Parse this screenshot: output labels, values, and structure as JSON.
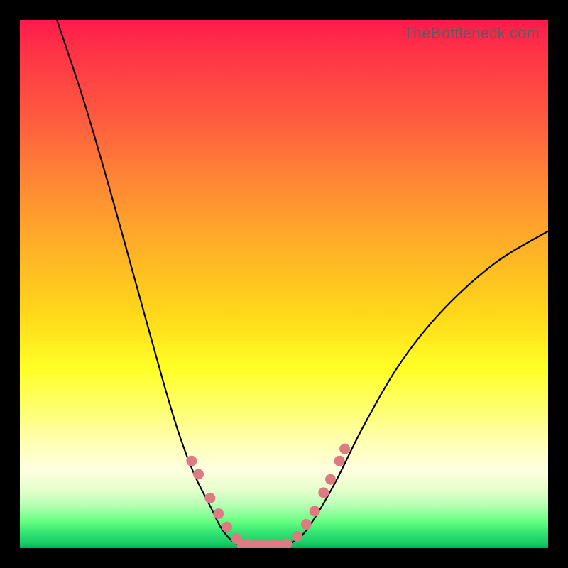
{
  "watermark": "TheBottleneck.com",
  "colors": {
    "frame": "#000000",
    "curve": "#000000",
    "marker": "#dd7b83",
    "gradient_top": "#ff1a4d",
    "gradient_bottom": "#00b359"
  },
  "chart_data": {
    "type": "line",
    "title": "",
    "xlabel": "",
    "ylabel": "",
    "xlim": [
      0,
      100
    ],
    "ylim": [
      0,
      100
    ],
    "annotations": [
      "TheBottleneck.com"
    ],
    "series": [
      {
        "name": "left-curve",
        "x": [
          7,
          12,
          17,
          22,
          27,
          30,
          33,
          36,
          38,
          40,
          42
        ],
        "y": [
          100,
          85,
          68,
          50,
          32,
          22,
          14,
          8,
          4,
          1.5,
          0.5
        ]
      },
      {
        "name": "right-curve",
        "x": [
          50,
          53,
          56,
          60,
          65,
          72,
          80,
          90,
          100
        ],
        "y": [
          0.5,
          2,
          6,
          13,
          23,
          35,
          45,
          54,
          60
        ]
      },
      {
        "name": "flat-bottom",
        "x": [
          42,
          50
        ],
        "y": [
          0.5,
          0.5
        ]
      }
    ],
    "markers_left": [
      {
        "x": 32.5,
        "y": 16.5
      },
      {
        "x": 33.8,
        "y": 14.0
      },
      {
        "x": 36.0,
        "y": 9.5
      },
      {
        "x": 37.6,
        "y": 6.5
      },
      {
        "x": 39.2,
        "y": 4.0
      },
      {
        "x": 41.0,
        "y": 1.8
      },
      {
        "x": 43.0,
        "y": 0.8
      },
      {
        "x": 45.5,
        "y": 0.5
      },
      {
        "x": 48.0,
        "y": 0.5
      }
    ],
    "markers_right": [
      {
        "x": 50.5,
        "y": 0.8
      },
      {
        "x": 52.5,
        "y": 2.2
      },
      {
        "x": 54.2,
        "y": 4.5
      },
      {
        "x": 55.8,
        "y": 7.0
      },
      {
        "x": 57.5,
        "y": 10.5
      },
      {
        "x": 58.8,
        "y": 13.0
      },
      {
        "x": 60.5,
        "y": 16.5
      },
      {
        "x": 61.5,
        "y": 18.8
      }
    ]
  }
}
